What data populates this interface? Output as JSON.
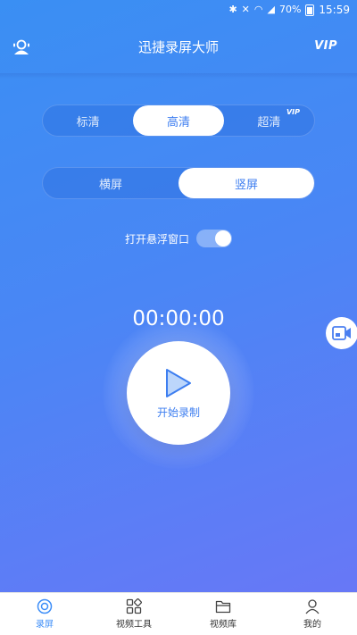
{
  "status_bar": {
    "battery": "70%",
    "time": "15:59",
    "icons": [
      "bluetooth-icon",
      "mute-icon",
      "wifi-icon",
      "signal-icon",
      "battery-icon"
    ]
  },
  "header": {
    "title": "迅捷录屏大师",
    "vip": "VIP",
    "left_icon": "user-icon"
  },
  "quality": {
    "options": [
      "标清",
      "高清",
      "超清"
    ],
    "selected": "高清",
    "vip_badge": "VIP"
  },
  "orientation": {
    "options": [
      "横屏",
      "竖屏"
    ],
    "selected": "竖屏"
  },
  "floating_window": {
    "label": "打开悬浮窗口",
    "enabled": true
  },
  "timer": "00:00:00",
  "record": {
    "label": "开始录制",
    "icon": "play-icon"
  },
  "side_button": {
    "icon": "video-camera-icon"
  },
  "bottom_nav": {
    "items": [
      {
        "label": "录屏",
        "icon": "record-icon",
        "active": true
      },
      {
        "label": "视频工具",
        "icon": "tools-grid-icon",
        "active": false
      },
      {
        "label": "视频库",
        "icon": "folder-icon",
        "active": false
      },
      {
        "label": "我的",
        "icon": "person-icon",
        "active": false
      }
    ]
  },
  "colors": {
    "accent": "#3d7ef0",
    "gradient_start": "#3a8ff3",
    "gradient_end": "#6b76f6"
  }
}
